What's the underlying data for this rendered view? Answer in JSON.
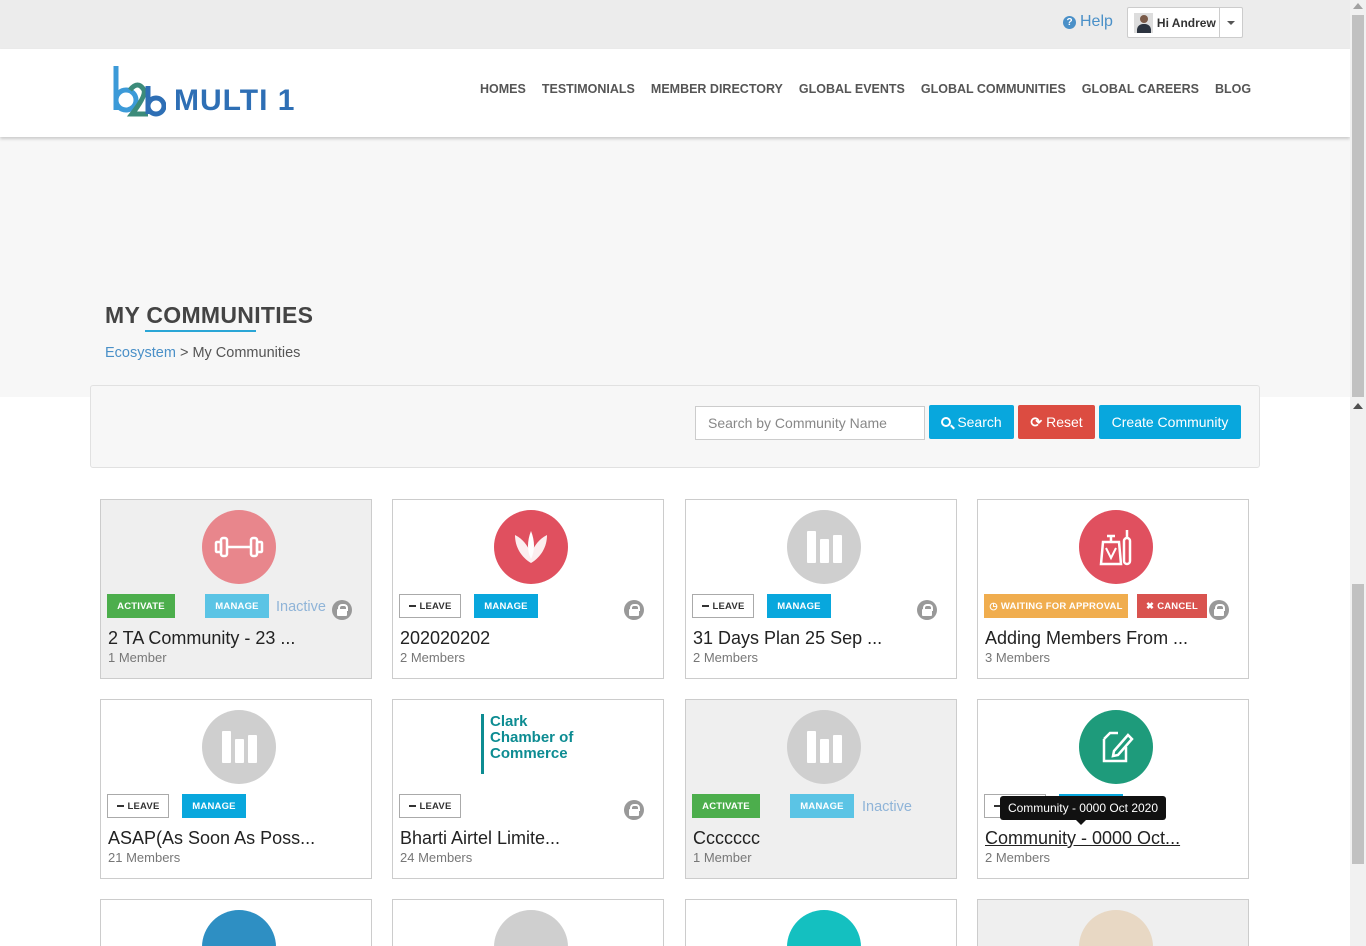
{
  "topbar": {
    "help_label": "Help",
    "user_greeting": "Hi Andrew"
  },
  "brand": {
    "logo_mark": "b2b",
    "logo_text": "MULTI 1"
  },
  "nav": [
    "HOMES",
    "TESTIMONIALS",
    "MEMBER DIRECTORY",
    "GLOBAL EVENTS",
    "GLOBAL COMMUNITIES",
    "GLOBAL CAREERS",
    "BLOG"
  ],
  "page": {
    "title": "MY COMMUNITIES",
    "breadcrumb_link": "Ecosystem",
    "breadcrumb_sep": ">",
    "breadcrumb_current": "My Communities"
  },
  "search": {
    "placeholder": "Search by Community Name",
    "search_label": "Search",
    "reset_label": "Reset",
    "create_label": "Create Community"
  },
  "labels": {
    "activate": "ACTIVATE",
    "manage": "MANAGE",
    "leave": "LEAVE",
    "inactive": "Inactive",
    "waiting": "WAITING FOR APPROVAL",
    "cancel": "CANCEL"
  },
  "cards": [
    {
      "title": "2 TA Community - 23 ...",
      "members": "1 Member",
      "icon": "dumbbell-icon",
      "color": "#e8868c"
    },
    {
      "title": "202020202",
      "members": "2 Members",
      "icon": "lotus-icon",
      "color": "#e0505f"
    },
    {
      "title": "31 Days Plan 25 Sep ...",
      "members": "2 Members",
      "icon": "books-icon",
      "color": "#cfcfcf"
    },
    {
      "title": "Adding Members From ...",
      "members": "3 Members",
      "icon": "perfume-icon",
      "color": "#e0505f"
    },
    {
      "title": "ASAP(As Soon As Poss...",
      "members": "21 Members",
      "icon": "books-icon",
      "color": "#cfcfcf"
    },
    {
      "title": "Bharti Airtel Limite...",
      "members": "24 Members",
      "icon": "clark-chamber-logo",
      "color": "#0d8c92",
      "logo_lines": [
        "Clark",
        "Chamber of",
        "Commerce"
      ]
    },
    {
      "title": "Ccccccc",
      "members": "1 Member",
      "icon": "books-icon",
      "color": "#cfcfcf"
    },
    {
      "title": "Community - 0000 Oct...",
      "members": "2 Members",
      "icon": "edit-icon",
      "color": "#1e9b7b"
    }
  ],
  "tooltip": "Community - 0000 Oct 2020",
  "partial_row_colors": [
    "#2e8fc3",
    "#cfcfcf",
    "#14c0c0",
    "#e8d8c4"
  ]
}
